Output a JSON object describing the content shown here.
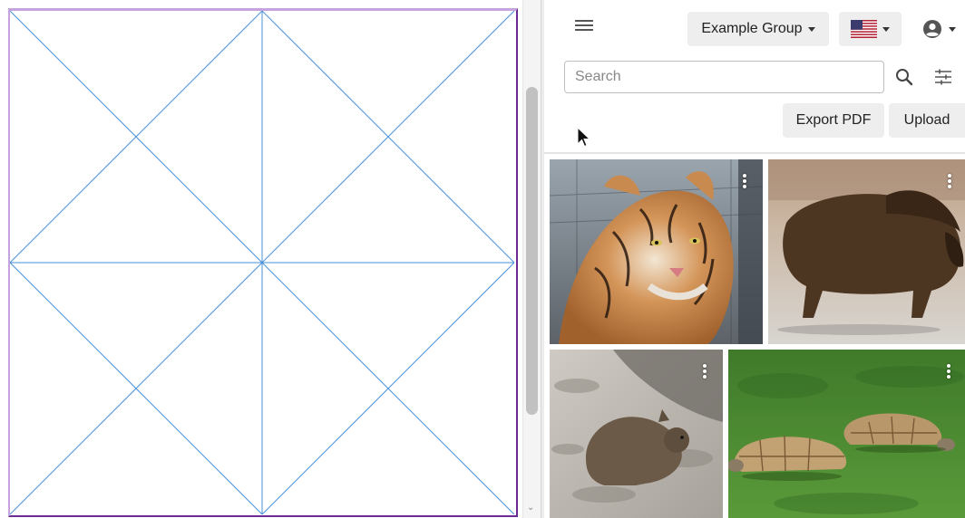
{
  "toolbar": {
    "menu_icon": "hamburger-menu-icon",
    "group_label": "Example Group",
    "language_flag": "us-flag-icon",
    "user_icon": "user-account-icon"
  },
  "search": {
    "placeholder": "Search",
    "value": "",
    "search_icon": "magnifier-icon",
    "filter_icon": "sliders-icon"
  },
  "actions": {
    "export_label": "Export PDF",
    "upload_label": "Upload"
  },
  "gallery": {
    "items": [
      {
        "subject": "tiger",
        "more_icon": "kebab-menu-icon"
      },
      {
        "subject": "bison",
        "more_icon": "kebab-menu-icon"
      },
      {
        "subject": "quokka",
        "more_icon": "kebab-menu-icon"
      },
      {
        "subject": "tortoises",
        "more_icon": "kebab-menu-icon"
      }
    ]
  },
  "colors": {
    "guide_lines": "#4a90d9",
    "page_border": "#6a2c8f",
    "button_bg": "#eeeeee"
  }
}
